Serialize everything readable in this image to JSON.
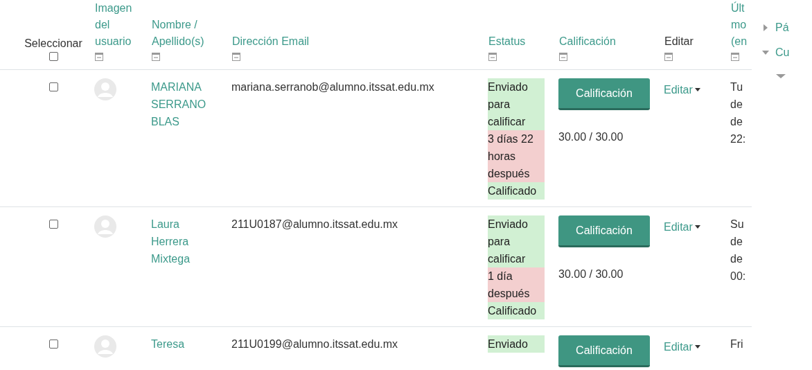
{
  "table": {
    "columns": [
      {
        "kind": "select",
        "label": "Seleccionar",
        "link": false,
        "checked": false
      },
      {
        "kind": "text",
        "label": "Imagen del usuario",
        "link": true
      },
      {
        "kind": "text",
        "label": "Nombre / Apellido(s)",
        "link": true
      },
      {
        "kind": "text",
        "label": "Dirección Email",
        "link": true
      },
      {
        "kind": "text",
        "label": "Estatus",
        "link": true
      },
      {
        "kind": "text",
        "label": "Calificación",
        "link": true
      },
      {
        "kind": "text",
        "label": "Editar",
        "link": false
      },
      {
        "kind": "cut",
        "lines": [
          "Últ",
          "mo",
          "(en"
        ],
        "link": true
      }
    ],
    "rows": [
      {
        "checked": false,
        "name": "MARIANA SERRANO BLAS",
        "email": "mariana.serranob@alumno.itssat.edu.mx",
        "status": [
          {
            "kind": "ok",
            "text": "Enviado para calificar"
          },
          {
            "kind": "late",
            "text": "3 días 22 horas después"
          },
          {
            "kind": "ok",
            "text": "Calificado"
          }
        ],
        "button": "Calificación",
        "grade": "30.00 / 30.00",
        "edit": "Editar",
        "last": [
          "Tu",
          "de",
          "de",
          "22:"
        ]
      },
      {
        "checked": false,
        "name": "Laura Herrera Mixtega",
        "email": "211U0187@alumno.itssat.edu.mx",
        "status": [
          {
            "kind": "ok",
            "text": "Enviado para calificar"
          },
          {
            "kind": "late",
            "text": "1 día después"
          },
          {
            "kind": "ok",
            "text": "Calificado"
          }
        ],
        "button": "Calificación",
        "grade": "30.00 / 30.00",
        "edit": "Editar",
        "last": [
          "Su",
          "de",
          "de",
          "00:"
        ]
      },
      {
        "checked": false,
        "name": "Teresa",
        "email": "211U0199@alumno.itssat.edu.mx",
        "status": [
          {
            "kind": "ok",
            "text": "Enviado"
          }
        ],
        "button": "Calificación",
        "edit": "Editar",
        "last": [
          "Fri"
        ]
      }
    ]
  },
  "sidebar": {
    "items": [
      {
        "label": "Pá",
        "expanded": false
      },
      {
        "label": "Cu",
        "expanded": true,
        "children": [
          {
            "expanded": true
          }
        ]
      }
    ]
  }
}
